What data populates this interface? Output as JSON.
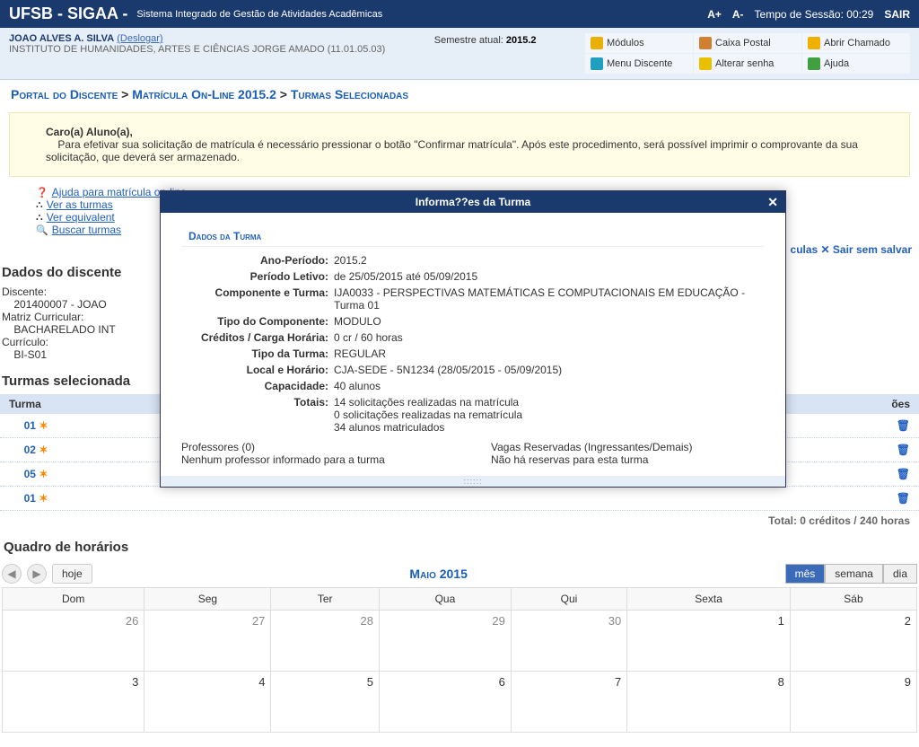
{
  "top": {
    "brand": "UFSB - SIGAA -",
    "system": "Sistema Integrado de Gestão de Atividades Acadêmicas",
    "aplus": "A+",
    "aminus": "A-",
    "session_label": "Tempo de Sessão:",
    "session_time": "00:29",
    "exit": "SAIR"
  },
  "user": {
    "name": "JOAO ALVES A. SILVA",
    "logout": "(Deslogar)",
    "inst": "INSTITUTO DE HUMANIDADES, ARTES E CIÊNCIAS JORGE AMADO (11.01.05.03)",
    "semester_label": "Semestre atual:",
    "semester": "2015.2"
  },
  "menu": {
    "m1": "Módulos",
    "m2": "Caixa Postal",
    "m3": "Abrir Chamado",
    "m4": "Menu Discente",
    "m5": "Alterar senha",
    "m6": "Ajuda"
  },
  "breadcrumb": {
    "a": "Portal do Discente",
    "s1": " > ",
    "b": "Matrícula On-Line 2015.2",
    "s2": " > ",
    "c": "Turmas Selecionadas"
  },
  "notice": {
    "greet": "Caro(a) Aluno(a),",
    "body": "Para efetivar sua solicitação de matrícula é necessário pressionar o botão \"Confirmar matrícula\". Após este procedimento, será possível imprimir o comprovante da sua solicitação, que deverá ser armazenado."
  },
  "links": {
    "l1": "Ajuda para matrícula on-line",
    "l2": "Ver as turmas",
    "l3": "Ver equivalent",
    "l4": "Buscar turmas",
    "l5": "culas ✕ Sair sem salvar"
  },
  "discente": {
    "title": "Dados do discente",
    "d1l": "Discente:",
    "d1v": "201400007 - JOAO",
    "d2l": "Matriz Curricular:",
    "d2v": "BACHARELADO INT",
    "d3l": "Currículo:",
    "d3v": "BI-S01"
  },
  "turmas": {
    "title": "Turmas selecionada",
    "h1": "Turma",
    "h3": "ões",
    "rows": [
      {
        "turma": "01",
        "star": "✶"
      },
      {
        "turma": "02",
        "star": "✶"
      },
      {
        "turma": "05",
        "star": "✶"
      },
      {
        "turma": "01",
        "star": "✶"
      }
    ],
    "totals": "Total: 0 créditos / 240 horas"
  },
  "quadro": {
    "title": "Quadro de horários",
    "hoje": "hoje",
    "month": "Maio 2015",
    "mes": "mês",
    "semana": "semana",
    "dia": "dia",
    "days": [
      "Dom",
      "Seg",
      "Ter",
      "Qua",
      "Qui",
      "Sexta",
      "Sáb"
    ],
    "week1": [
      "26",
      "27",
      "28",
      "29",
      "30",
      "1",
      "2"
    ],
    "week2": [
      "3",
      "4",
      "5",
      "6",
      "7",
      "8",
      "9"
    ]
  },
  "modal": {
    "title": "Informa??es da Turma",
    "sub": "Dados da Turma",
    "rows": {
      "r1l": "Ano-Período:",
      "r1v": "2015.2",
      "r2l": "Período Letivo:",
      "r2v": "de 25/05/2015 até 05/09/2015",
      "r3l": "Componente e Turma:",
      "r3v": "IJA0033 - PERSPECTIVAS MATEMÁTICAS E COMPUTACIONAIS EM EDUCAÇÃO - Turma 01",
      "r4l": "Tipo do Componente:",
      "r4v": "MODULO",
      "r5l": "Créditos / Carga Horária:",
      "r5v": "0 cr / 60 horas",
      "r6l": "Tipo da Turma:",
      "r6v": "REGULAR",
      "r7l": "Local e Horário:",
      "r7v": "CJA-SEDE - 5N1234 (28/05/2015 - 05/09/2015)",
      "r8l": "Capacidade:",
      "r8v": "40 alunos",
      "r9l": "Totais:",
      "r9v1": "14 solicitações realizadas na matrícula",
      "r9v2": "0 solicitações realizadas na rematrícula",
      "r9v3": "34 alunos matriculados"
    },
    "bottom": {
      "profh": "Professores (0)",
      "profv": "Nenhum professor informado para a turma",
      "vagh": "Vagas Reservadas (Ingressantes/Demais)",
      "vagv": "Não há reservas para esta turma"
    }
  }
}
